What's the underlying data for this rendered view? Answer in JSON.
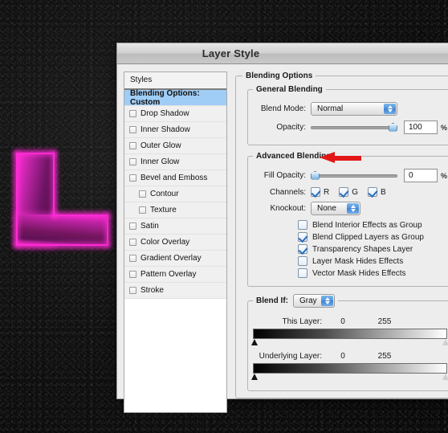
{
  "window": {
    "title": "Layer Style"
  },
  "styles_panel": {
    "header": "Styles",
    "items": [
      {
        "label": "Blending Options: Custom",
        "selected": true,
        "checkbox": false,
        "indent": false
      },
      {
        "label": "Drop Shadow",
        "selected": false,
        "checkbox": true,
        "checked": false,
        "indent": false
      },
      {
        "label": "Inner Shadow",
        "selected": false,
        "checkbox": true,
        "checked": false,
        "indent": false
      },
      {
        "label": "Outer Glow",
        "selected": false,
        "checkbox": true,
        "checked": false,
        "indent": false
      },
      {
        "label": "Inner Glow",
        "selected": false,
        "checkbox": true,
        "checked": false,
        "indent": false
      },
      {
        "label": "Bevel and Emboss",
        "selected": false,
        "checkbox": true,
        "checked": false,
        "indent": false
      },
      {
        "label": "Contour",
        "selected": false,
        "checkbox": true,
        "checked": false,
        "indent": true
      },
      {
        "label": "Texture",
        "selected": false,
        "checkbox": true,
        "checked": false,
        "indent": true
      },
      {
        "label": "Satin",
        "selected": false,
        "checkbox": true,
        "checked": false,
        "indent": false
      },
      {
        "label": "Color Overlay",
        "selected": false,
        "checkbox": true,
        "checked": false,
        "indent": false
      },
      {
        "label": "Gradient Overlay",
        "selected": false,
        "checkbox": true,
        "checked": false,
        "indent": false
      },
      {
        "label": "Pattern Overlay",
        "selected": false,
        "checkbox": true,
        "checked": false,
        "indent": false
      },
      {
        "label": "Stroke",
        "selected": false,
        "checkbox": true,
        "checked": false,
        "indent": false
      }
    ]
  },
  "blending_options": {
    "legend": "Blending Options",
    "general": {
      "legend": "General Blending",
      "blend_mode_label": "Blend Mode:",
      "blend_mode_value": "Normal",
      "opacity_label": "Opacity:",
      "opacity_value": "100",
      "opacity_unit": "%",
      "opacity_percent": 100
    },
    "advanced": {
      "legend": "Advanced Blending",
      "fill_opacity_label": "Fill Opacity:",
      "fill_opacity_value": "0",
      "fill_opacity_unit": "%",
      "fill_opacity_percent": 0,
      "channels_label": "Channels:",
      "channels": [
        {
          "label": "R",
          "checked": true
        },
        {
          "label": "G",
          "checked": true
        },
        {
          "label": "B",
          "checked": true
        }
      ],
      "knockout_label": "Knockout:",
      "knockout_value": "None",
      "options": [
        {
          "label": "Blend Interior Effects as Group",
          "checked": false
        },
        {
          "label": "Blend Clipped Layers as Group",
          "checked": true
        },
        {
          "label": "Transparency Shapes Layer",
          "checked": true
        },
        {
          "label": "Layer Mask Hides Effects",
          "checked": false
        },
        {
          "label": "Vector Mask Hides Effects",
          "checked": false
        }
      ]
    },
    "blend_if": {
      "legend": "Blend If:",
      "channel_value": "Gray",
      "this_layer": {
        "label": "This Layer:",
        "min": "0",
        "max": "255"
      },
      "underlying_layer": {
        "label": "Underlying Layer:",
        "min": "0",
        "max": "255"
      }
    }
  },
  "annotation": {
    "arrow": "red-left-arrow",
    "points_at": "fill-opacity-slider"
  },
  "artwork": {
    "letter": "L",
    "glow_color": "#ff2ad4",
    "core_color": "#5c1253"
  },
  "colors": {
    "selection_blue": "#9fcdf5",
    "annotation_red": "#e31717",
    "dialog_gray": "#ededed"
  }
}
